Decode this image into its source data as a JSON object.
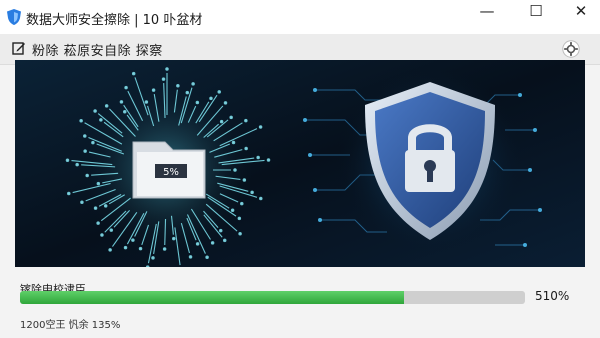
{
  "window": {
    "title": "数据大师安全擦除 | 10 卟盆材",
    "minimize_glyph": "—",
    "maximize_glyph": "☐",
    "close_glyph": "✕"
  },
  "toolbar": {
    "label": "粉除 菘原安自除 探察"
  },
  "hero": {
    "file_badge": "5%"
  },
  "progress": {
    "label": "镓除申校逮臣",
    "value_fraction": 0.76,
    "percent_text": "510%",
    "status_text": "1200空王 忛余 135%",
    "fill_color": "#3cb043",
    "track_color": "#cfcfcf"
  },
  "colors": {
    "brand": "#2a7de1",
    "hero_bg": "#06101c",
    "shield_blue": "#2f5fa8",
    "glow_cyan": "#38c8e8"
  },
  "icons": {
    "app": "shield-icon",
    "toolbar": "edit-icon",
    "settings": "gear-icon",
    "file": "folder-file-icon",
    "shield": "shield-lock-icon"
  }
}
